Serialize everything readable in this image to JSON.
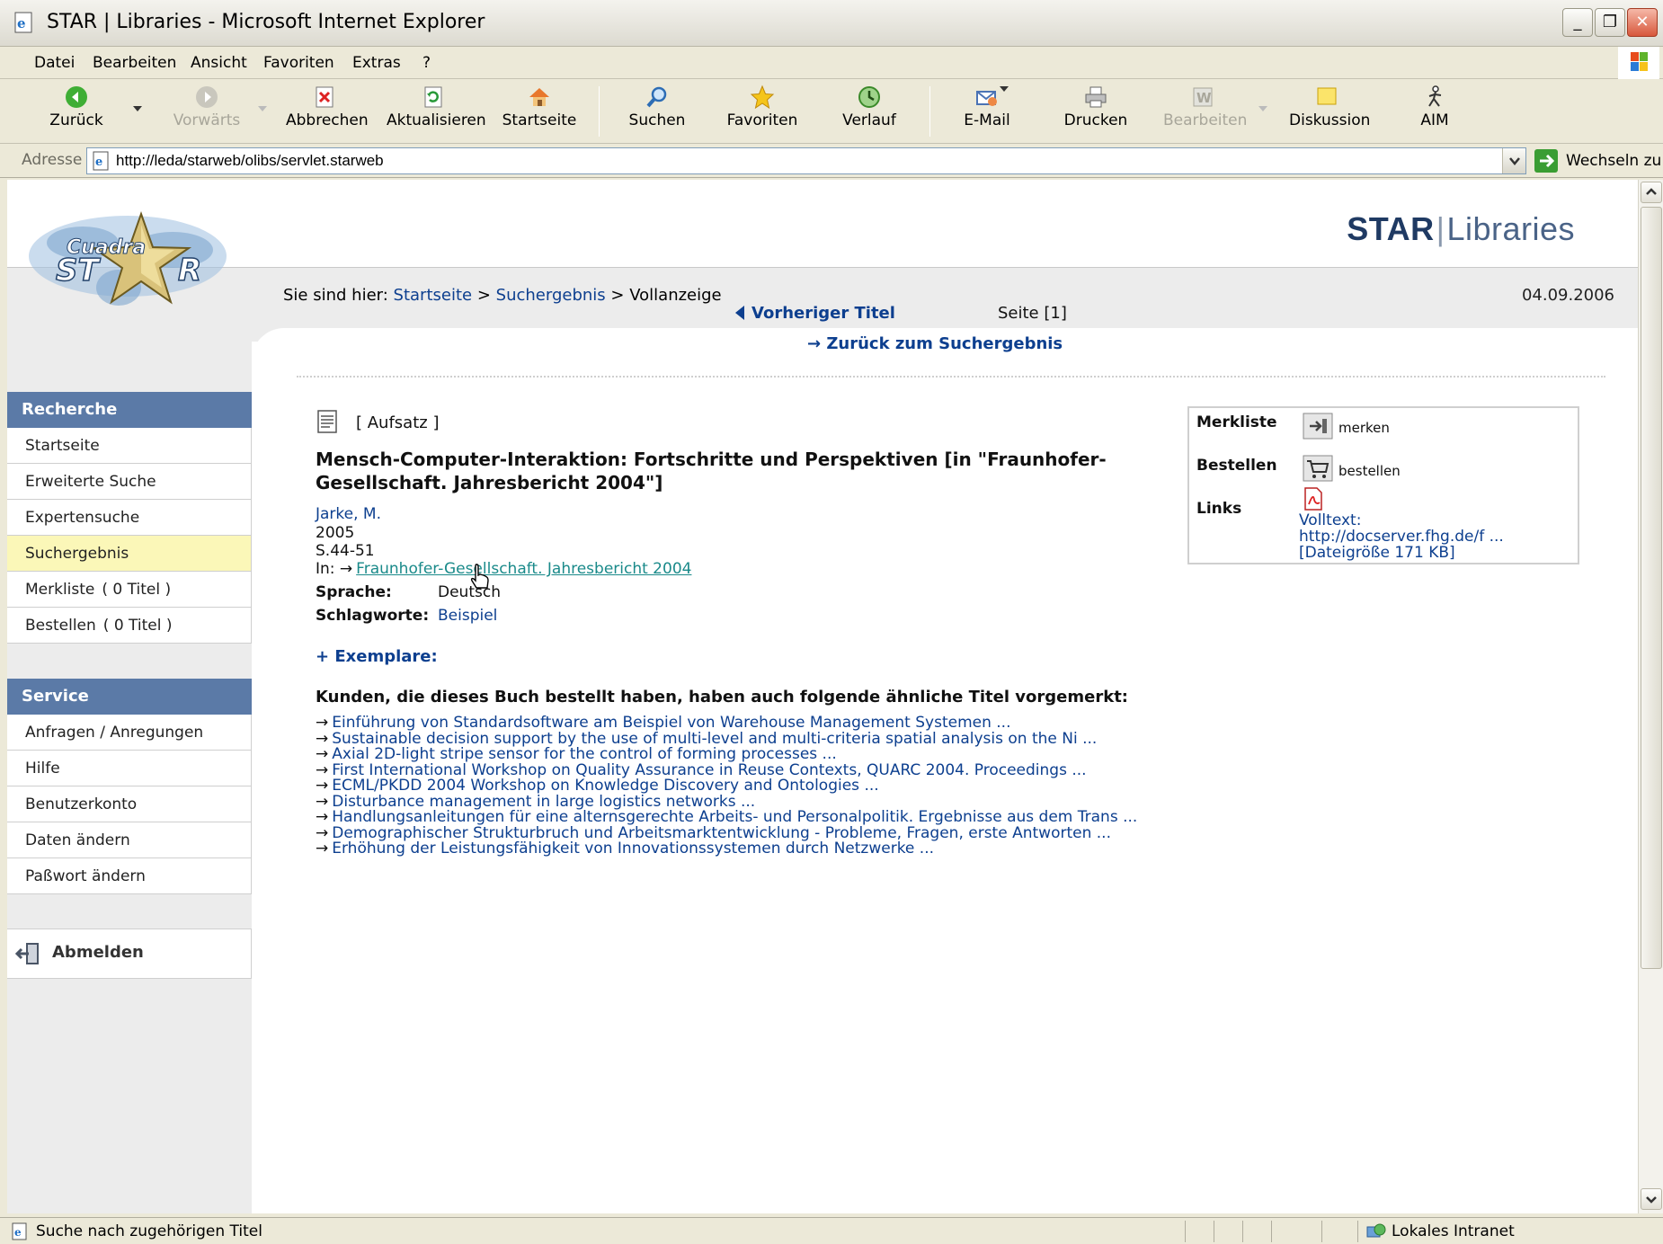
{
  "window": {
    "title": "STAR | Libraries - Microsoft Internet Explorer",
    "minimize": "_",
    "maximize": "❐",
    "close": "✕"
  },
  "menu": [
    "Datei",
    "Bearbeiten",
    "Ansicht",
    "Favoriten",
    "Extras",
    "?"
  ],
  "toolbar": {
    "back": "Zurück",
    "forward": "Vorwärts",
    "stop": "Abbrechen",
    "refresh": "Aktualisieren",
    "home": "Startseite",
    "search": "Suchen",
    "favorites": "Favoriten",
    "history": "Verlauf",
    "mail": "E-Mail",
    "print": "Drucken",
    "edit": "Bearbeiten",
    "discuss": "Diskussion",
    "aim": "AIM"
  },
  "address": {
    "label": "Adresse",
    "url": "http://leda/starweb/olibs/servlet.starweb",
    "go": "Wechseln zu"
  },
  "page": {
    "brand_a": "STAR",
    "brand_sep": "|",
    "brand_b": "Libraries",
    "breadcrumb": {
      "prefix": "Sie sind hier:",
      "home": "Startseite",
      "sep1": ">",
      "results": "Suchergebnis",
      "sep2": ">",
      "current": "Vollanzeige"
    },
    "date": "04.09.2006"
  },
  "sidebar": {
    "recherche_head": "Recherche",
    "recherche_items": [
      {
        "label": "Startseite"
      },
      {
        "label": "Erweiterte Suche"
      },
      {
        "label": "Expertensuche"
      },
      {
        "label": "Suchergebnis"
      },
      {
        "label": "Merkliste",
        "count": "( 0 Titel )"
      },
      {
        "label": "Bestellen",
        "count": "( 0 Titel )"
      }
    ],
    "service_head": "Service",
    "service_items": [
      {
        "label": "Anfragen / Anregungen"
      },
      {
        "label": "Hilfe"
      },
      {
        "label": "Benutzerkonto"
      },
      {
        "label": "Daten ändern"
      },
      {
        "label": "Paßwort ändern"
      }
    ],
    "logout": "Abmelden"
  },
  "nav": {
    "prev_title": "Vorheriger Titel",
    "page_indicator": "Seite [1]",
    "back_to_results": "→ Zurück zum Suchergebnis"
  },
  "record": {
    "type": "[ Aufsatz ]",
    "title": "Mensch-Computer-Interaktion: Fortschritte und Perspektiven [in \"Fraunhofer-Gesellschaft. Jahresbericht 2004\"]",
    "author": "Jarke, M.",
    "year": "2005",
    "pages": "S.44-51",
    "in_prefix": "In: →",
    "in_link": "Fraunhofer-Gesellschaft. Jahresbericht 2004",
    "language_label": "Sprache:",
    "language_value": "Deutsch",
    "keywords_label": "Schlagworte:",
    "keywords_value": "Beispiel",
    "copies": "+ Exemplare:"
  },
  "also_bought": {
    "heading": "Kunden, die dieses Buch bestellt haben, haben auch folgende ähnliche Titel vorgemerkt:",
    "arrow": "→",
    "items": [
      "Einführung von Standardsoftware am Beispiel von Warehouse Management Systemen ...",
      "Sustainable decision support by the use of multi-level and multi-criteria spatial analysis on the Ni ...",
      "Axial 2D-light stripe sensor for the control of forming processes ...",
      "First International Workshop on Quality Assurance in Reuse Contexts, QUARC 2004. Proceedings ...",
      "ECML/PKDD 2004 Workshop on Knowledge Discovery and Ontologies ...",
      "Disturbance management in large logistics networks ...",
      "Handlungsanleitungen für eine alternsgerechte Arbeits- und Personalpolitik. Ergebnisse aus dem Trans ...",
      "Demographischer Strukturbruch und Arbeitsmarktentwicklung - Probleme, Fragen, erste Antworten ...",
      "Erhöhung der Leistungsfähigkeit von Innovationssystemen durch Netzwerke ..."
    ]
  },
  "infobox": {
    "merkliste_label": "Merkliste",
    "merkliste_action": "merken",
    "bestellen_label": "Bestellen",
    "bestellen_action": "bestellen",
    "links_label": "Links",
    "link_line1": "Volltext:",
    "link_line2": "http://docserver.fhg.de/f ...",
    "link_line3": "[Dateigröße 171 KB]"
  },
  "status": {
    "text": "Suche nach zugehörigen Titel",
    "zone": "Lokales Intranet"
  },
  "colors": {
    "nav_head": "#5b7aa7",
    "link": "#0d3f8f",
    "active_item": "#fbf7b8"
  }
}
